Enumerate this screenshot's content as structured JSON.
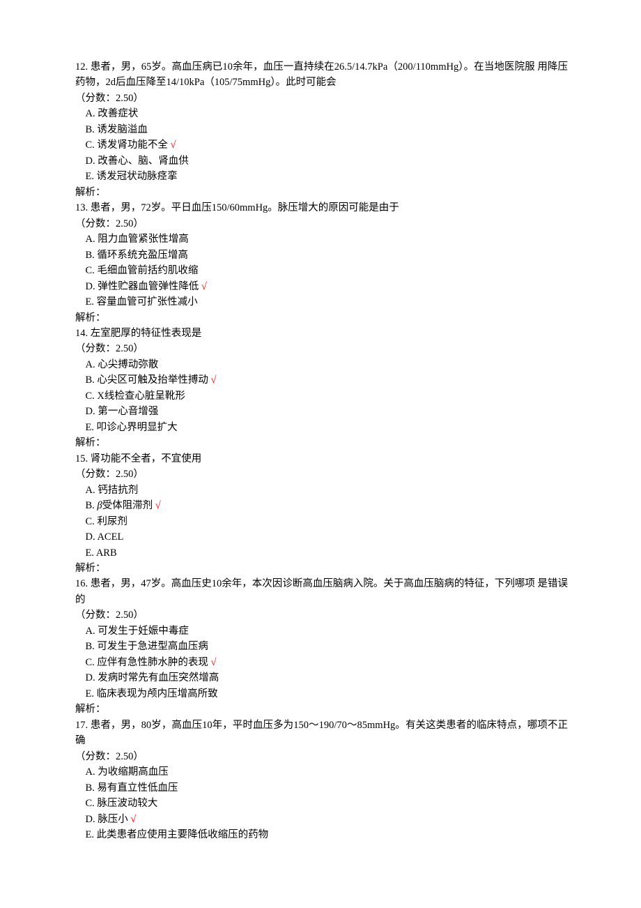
{
  "questions": [
    {
      "num": "12.",
      "stem": "患者，男，65岁。高血压病已10余年，血压一直持续在26.5/14.7kPa（200/110mmHg）。在当地医院服 用降压药物，2d后血压降至14/10kPa（105/75mmHg）。此时可能会",
      "score": "（分数：2.50）",
      "options": [
        {
          "label": "A.",
          "text": "改善症状",
          "correct": false
        },
        {
          "label": "B.",
          "text": "诱发脑溢血",
          "correct": false
        },
        {
          "label": "C.",
          "text": "诱发肾功能不全",
          "correct": true
        },
        {
          "label": "D.",
          "text": "改善心、脑、肾血供",
          "correct": false
        },
        {
          "label": "E.",
          "text": "诱发冠状动脉痉挛",
          "correct": false
        }
      ],
      "analysis": "解析："
    },
    {
      "num": "13.",
      "stem": "患者，男，72岁。平日血压150/60mmHg。脉压增大的原因可能是由于",
      "score": "（分数：2.50）",
      "options": [
        {
          "label": "A.",
          "text": "阻力血管紧张性增高",
          "correct": false
        },
        {
          "label": "B.",
          "text": "循环系统充盈压增高",
          "correct": false
        },
        {
          "label": "C.",
          "text": "毛细血管前括约肌收缩",
          "correct": false
        },
        {
          "label": "D.",
          "text": "弹性贮器血管弹性降低",
          "correct": true
        },
        {
          "label": "E.",
          "text": "容量血管可扩张性减小",
          "correct": false
        }
      ],
      "analysis": "解析："
    },
    {
      "num": "14.",
      "stem": "左室肥厚的特征性表现是",
      "score": "（分数：2.50）",
      "options": [
        {
          "label": "A.",
          "text": "心尖搏动弥散",
          "correct": false
        },
        {
          "label": "B.",
          "text": "心尖区可触及抬举性搏动",
          "correct": true
        },
        {
          "label": "C.",
          "text": "X线检查心脏呈靴形",
          "correct": false
        },
        {
          "label": "D.",
          "text": "第一心音增强",
          "correct": false
        },
        {
          "label": "E.",
          "text": "叩诊心界明显扩大",
          "correct": false
        }
      ],
      "analysis": "解析："
    },
    {
      "num": "15.",
      "stem": "肾功能不全者，不宜使用",
      "score": "（分数：2.50）",
      "options": [
        {
          "label": "A.",
          "text": "钙拮抗剂",
          "correct": false
        },
        {
          "label": "B.",
          "text_pre": "",
          "italic": "β",
          "text": "受体阻滞剂",
          "correct": true
        },
        {
          "label": "C.",
          "text": "利尿剂",
          "correct": false
        },
        {
          "label": "D.",
          "text": "ACEL",
          "correct": false
        },
        {
          "label": "E.",
          "text": "ARB",
          "correct": false
        }
      ],
      "analysis": "解析："
    },
    {
      "num": "16.",
      "stem": "患者，男，47岁。高血压史10余年，本次因诊断高血压脑病入院。关于高血压脑病的特征，下列哪项 是错误的",
      "score": "（分数：2.50）",
      "options": [
        {
          "label": "A.",
          "text": "可发生于妊娠中毒症",
          "correct": false
        },
        {
          "label": "B.",
          "text": "可发生于急进型高血压病",
          "correct": false
        },
        {
          "label": "C.",
          "text": "应伴有急性肺水肿的表现",
          "correct": true
        },
        {
          "label": "D.",
          "text": "发病时常先有血压突然增高",
          "correct": false
        },
        {
          "label": "E.",
          "text": "临床表现为颅内压增高所致",
          "correct": false
        }
      ],
      "analysis": "解析："
    },
    {
      "num": "17.",
      "stem": "患者，男，80岁，高血压10年，平时血压多为150～190/70～85mmHg。有关这类患者的临床特点，哪项不正确",
      "score": "（分数：2.50）",
      "options": [
        {
          "label": "A.",
          "text": "为收缩期高血压",
          "correct": false
        },
        {
          "label": "B.",
          "text": "易有直立性低血压",
          "correct": false
        },
        {
          "label": "C.",
          "text": "脉压波动较大",
          "correct": false
        },
        {
          "label": "D.",
          "text": "脉压小",
          "correct": true
        },
        {
          "label": "E.",
          "text": " 此类患者应使用主要降低收缩压的药物",
          "correct": false
        }
      ],
      "analysis": ""
    }
  ],
  "check_mark": "√"
}
